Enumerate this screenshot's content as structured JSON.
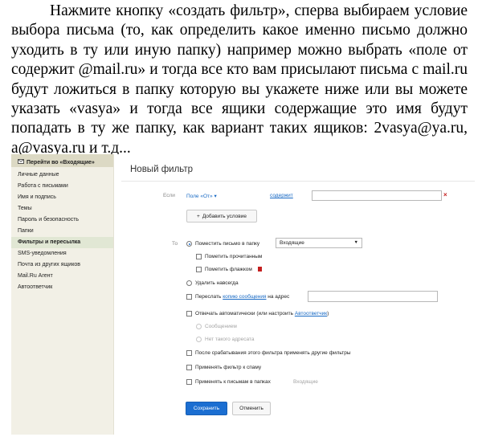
{
  "paragraph": {
    "lines": [
      "Нажмите кнопку «создать фильтр», сперва выбираем условие",
      "выбора письма (то, как определить какое именно письмо должно",
      "уходить в ту или иную папку) например можно выбрать «поле от",
      "содержит @mail.ru» и тогда все кто вам присылают письма с mail.ru",
      "будут ложиться в папку которую вы укажете ниже или вы можете",
      "указать «vasya» и тогда все ящики содержащие это имя будут",
      "попадать в ту же папку, как вариант таких ящиков: 2vasya@ya.ru,",
      "a@vasya.ru и т.д..."
    ]
  },
  "sidebar": {
    "back_label": "Перейти во «Входящие»",
    "back_icon": "envelope-icon",
    "items": [
      "Личные данные",
      "Работа с письмами",
      "Имя и подпись",
      "Темы",
      "Пароль и безопасность",
      "Папки",
      "Фильтры и пересылка",
      "SMS-уведомления",
      "Почта из других ящиков",
      "Mail.Ru Агент",
      "Автоответчик"
    ],
    "active_item": "Фильтры и пересылка"
  },
  "main": {
    "title": "Новый фильтр",
    "condition": {
      "if_label": "Если",
      "field_select": "Поле «От»",
      "operator": "содержит",
      "value": "",
      "add_condition_label": "Добавить условие"
    },
    "actions": {
      "to_label": "То",
      "move_label": "Поместить письмо в папку",
      "folder_select": "Входящие",
      "mark_read_label": "Пометить прочитанным",
      "mark_flag_label": "Пометить флажком",
      "delete_label": "Удалить навсегда",
      "forward_prefix": "Переслать ",
      "forward_link": "копию сообщения",
      "forward_suffix": " на адрес",
      "autoreply_prefix": "Отвечать автоматически (или настроить ",
      "autoreply_link": "Автоответчик",
      "autoreply_suffix": ")",
      "autoreply_message_label": "Сообщением",
      "autoreply_no_recipient_label": "Нет такого адресата",
      "apply_other_filters_label": "После срабатывания этого фильтра применять другие фильтры",
      "apply_to_spam_label": "Применять фильтр к спаму",
      "apply_to_folders_label": "Применять к письмам в папках",
      "apply_folders_select": "Входящие"
    },
    "buttons": {
      "save": "Сохранить",
      "cancel": "Отменить"
    }
  },
  "colors": {
    "primary_button": "#1b6ed1",
    "link": "#1769c4",
    "sidebar_bg": "#f2f0e6",
    "sidebar_active": "#e1e7d4",
    "delete_x": "#c41f1f"
  }
}
